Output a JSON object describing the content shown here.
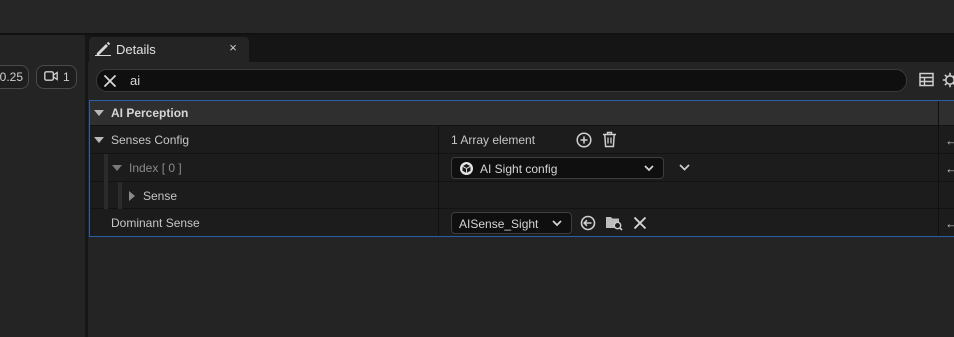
{
  "left_toolbar": {
    "zoom_value": "0.25",
    "camera_count": "1",
    "camera_icon": "video-camera-icon"
  },
  "tab": {
    "title": "Details",
    "close_symbol": "×",
    "icon": "pencil-icon"
  },
  "search": {
    "value": "ai",
    "clear_icon": "close-icon"
  },
  "toolbar_icons": [
    "table-view-icon",
    "settings-gear-icon"
  ],
  "category": {
    "label": "AI Perception"
  },
  "properties": {
    "senses_config": {
      "label": "Senses Config",
      "value": "1 Array element",
      "actions": [
        "add-element-icon",
        "delete-all-icon"
      ]
    },
    "index": {
      "label": "Index [ 0 ]",
      "value": "AI Sight config",
      "value_icon": "blueprint-class-icon"
    },
    "sense": {
      "label": "Sense"
    },
    "dominant_sense": {
      "label": "Dominant Sense",
      "value": "AISense_Sight",
      "actions": [
        "use-selected-asset-icon",
        "browse-asset-icon",
        "clear-icon"
      ]
    }
  },
  "reset_symbol": "←",
  "colors": {
    "background": "#151515",
    "panel": "#242424",
    "row": "#1c1c1c",
    "category_row": "#2f2f2f",
    "selection_border": "#2a5fa8",
    "text": "#c6c6c6"
  }
}
